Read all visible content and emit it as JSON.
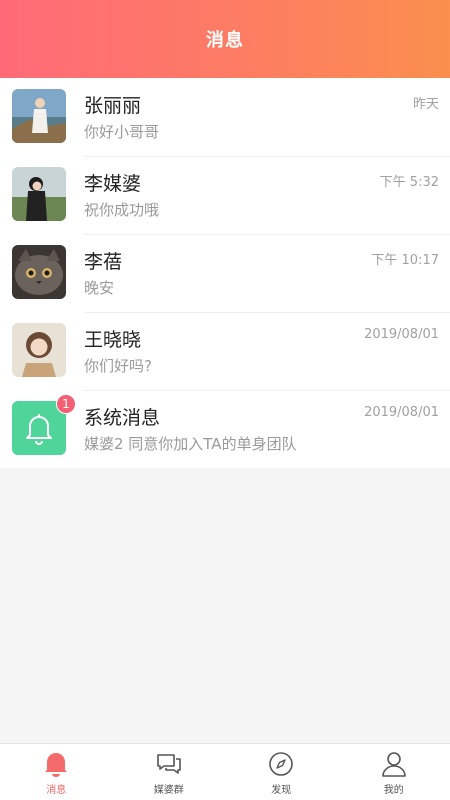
{
  "header": {
    "title": "消息"
  },
  "conversations": [
    {
      "name": "张丽丽",
      "preview": "你好小哥哥",
      "time": "昨天",
      "avatar": "photo-girl-cliff"
    },
    {
      "name": "李媒婆",
      "preview": "祝你成功哦",
      "time": "下午 5:32",
      "avatar": "photo-girl-field"
    },
    {
      "name": "李蓓",
      "preview": "晚安",
      "time": "下午 10:17",
      "avatar": "photo-cat"
    },
    {
      "name": "王晓晓",
      "preview": "你们好吗?",
      "time": "2019/08/01",
      "avatar": "photo-girl-beige"
    },
    {
      "name": "系统消息",
      "preview": "媒婆2 同意你加入TA的单身团队",
      "time": "2019/08/01",
      "avatar": "bell-icon",
      "badge": "1"
    }
  ],
  "tabbar": {
    "items": [
      {
        "label": "消息",
        "icon": "bell-icon",
        "active": true
      },
      {
        "label": "媒婆群",
        "icon": "chat-bubbles-icon",
        "active": false
      },
      {
        "label": "发现",
        "icon": "compass-icon",
        "active": false
      },
      {
        "label": "我的",
        "icon": "user-icon",
        "active": false
      }
    ]
  },
  "colors": {
    "header_gradient_start": "#fe6a78",
    "header_gradient_end": "#fa8f4e",
    "accent": "#f56a6a",
    "system_icon_bg": "#4fd49a",
    "badge": "#f45f73"
  }
}
